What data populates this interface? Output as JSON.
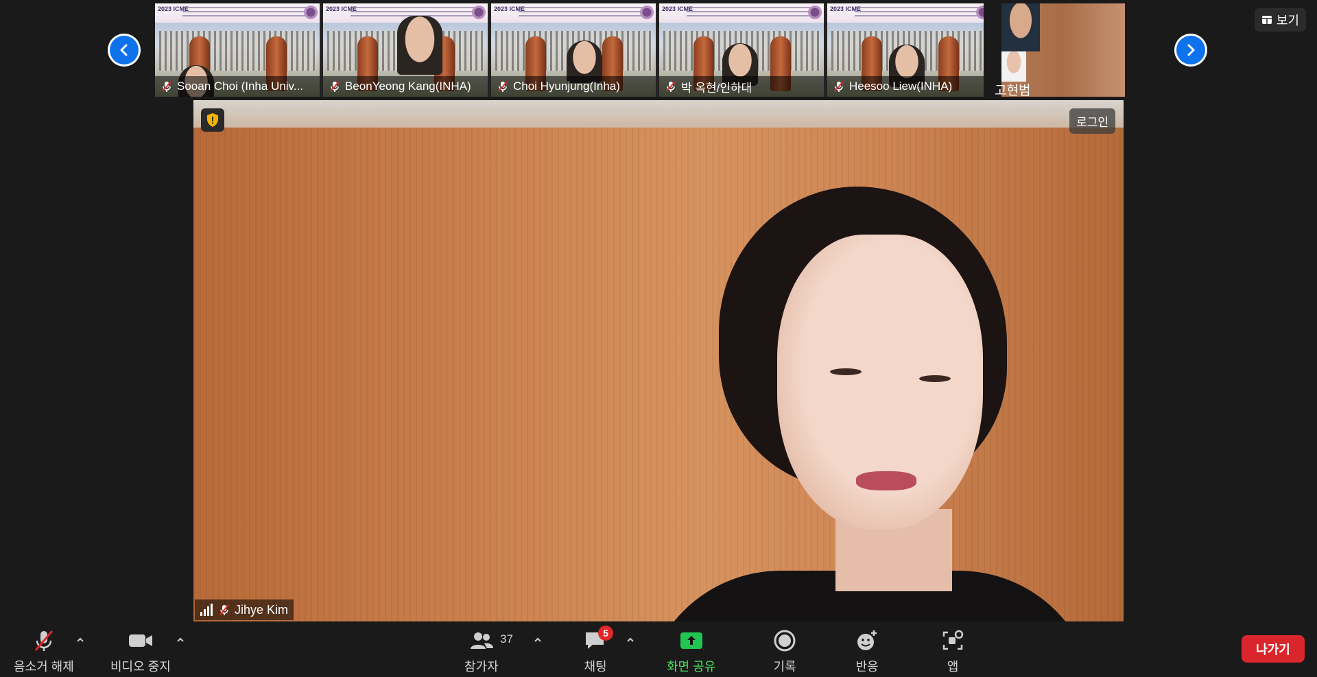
{
  "top_bar": {
    "view_label": "보기",
    "thumbnails": [
      {
        "name": "Sooan Choi (Inha Univ...",
        "muted": true,
        "banner_text": "2023 ICME"
      },
      {
        "name": "BeonYeong Kang(INHA)",
        "muted": true,
        "banner_text": "2023 ICME"
      },
      {
        "name": "Choi Hyunjung(Inha)",
        "muted": true,
        "banner_text": "2023 ICME"
      },
      {
        "name": "박 옥현/인하대",
        "muted": true,
        "banner_text": "2023 ICME"
      },
      {
        "name": "Heesoo Liew(INHA)",
        "muted": true,
        "banner_text": "2023 ICME"
      },
      {
        "name": "고현범",
        "muted": false
      }
    ]
  },
  "main_video": {
    "speaker_name": "Jihye Kim",
    "login_label": "로그인"
  },
  "toolbar": {
    "unmute_label": "음소거 해제",
    "video_stop_label": "비디오 중지",
    "participants_label": "참가자",
    "participants_count": "37",
    "chat_label": "채팅",
    "chat_badge": "5",
    "share_label": "화면 공유",
    "record_label": "기록",
    "reactions_label": "반응",
    "apps_label": "앱",
    "leave_label": "나가기"
  },
  "colors": {
    "accent_blue": "#0e72ed",
    "share_green": "#23c552",
    "leave_red": "#d9262c",
    "badge_red": "#e02828"
  }
}
